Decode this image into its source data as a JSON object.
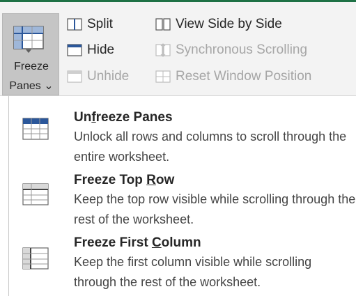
{
  "ribbon": {
    "freeze_button": {
      "label_line1": "Freeze",
      "label_line2": "Panes"
    },
    "split_label": "Split",
    "hide_label": "Hide",
    "unhide_label": "Unhide",
    "view_side_by_side_label": "View Side by Side",
    "synchronous_scrolling_label": "Synchronous Scrolling",
    "reset_window_position_label": "Reset Window Position"
  },
  "menu": {
    "items": [
      {
        "title_pre": "Un",
        "title_key": "f",
        "title_post": "reeze Panes",
        "desc": "Unlock all rows and columns to scroll through the entire worksheet."
      },
      {
        "title_pre": "Freeze Top ",
        "title_key": "R",
        "title_post": "ow",
        "desc": "Keep the top row visible while scrolling through the rest of the worksheet."
      },
      {
        "title_pre": "Freeze First ",
        "title_key": "C",
        "title_post": "olumn",
        "desc": "Keep the first column visible while scrolling through the rest of the worksheet."
      }
    ]
  },
  "colors": {
    "accent_green": "#1e7145",
    "pressed_bg": "#c5c5c5",
    "icon_blue": "#2b579a"
  }
}
